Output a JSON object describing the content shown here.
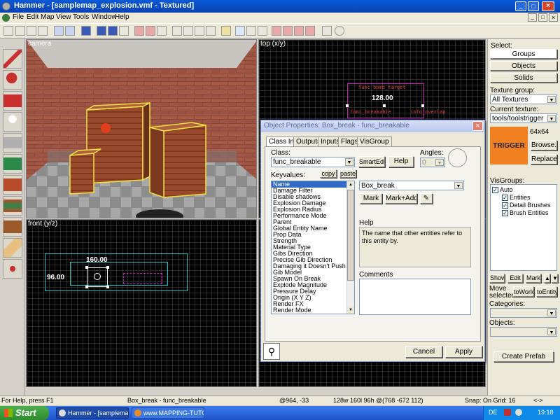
{
  "window": {
    "title": "Hammer - [samplemap_explosion.vmf - Textured]"
  },
  "menu": {
    "items": [
      "File",
      "Edit",
      "Map",
      "View",
      "Tools",
      "Window",
      "Help"
    ]
  },
  "viewports": {
    "camera": "camera",
    "top": "top (x/y)",
    "front": "front (y/z)",
    "top_entity_label_1": "func_bomb_target",
    "top_entity_label_2": "func_breakable",
    "top_entity_label_3": "info_overlap",
    "top_dimension": "128.00",
    "front_width": "160.00",
    "front_height": "96.00"
  },
  "dialog": {
    "title": "Object Properties: Box_break - func_breakable",
    "tabs": [
      "Class Info",
      "Outputs",
      "Inputs",
      "Flags",
      "VisGroup"
    ],
    "class_label": "Class:",
    "class_value": "func_breakable",
    "smartedit_label": "SmartEdit",
    "help_button": "Help",
    "angles_label": "Angles:",
    "angles_value": "0",
    "keyvalues_label": "Keyvalues:",
    "copy_label": "copy",
    "paste_label": "paste",
    "keyvalues": [
      "Name",
      "Damage Filter",
      "Disable shadows",
      "Explosion Damage",
      "Explosion Radius",
      "Performance Mode",
      "Parent",
      "Global Entity Name",
      "Prop Data",
      "Strength",
      "Material Type",
      "Gibs Direction",
      "Precise Gib Direction",
      "Damaging it Doesn't Push It",
      "Gib Model",
      "Spawn On Break",
      "Explode Magnitude",
      "Pressure Delay",
      "Origin (X Y Z)",
      "Render FX",
      "Render Mode"
    ],
    "value_field": "Box_break",
    "mark_label": "Mark",
    "markadd_label": "Mark+Add",
    "help_section_label": "Help",
    "help_text": "The name that other entities refer to this entity by.",
    "comments_label": "Comments",
    "cancel_label": "Cancel",
    "apply_label": "Apply"
  },
  "rightpanel": {
    "select_label": "Select:",
    "groups_label": "Groups",
    "objects_label": "Objects",
    "solids_label": "Solids",
    "texture_group_label": "Texture group:",
    "texture_group_value": "All Textures",
    "current_texture_label": "Current texture:",
    "current_texture_value": "tools/toolstrigger",
    "texture_preview_text": "TRIGGER",
    "texture_size": "64x64",
    "browse_label": "Browse...",
    "replace_label": "Replace...",
    "visgroups_label": "VisGroups:",
    "visgroup_root": "Auto",
    "visgroup_children": [
      "Entities",
      "Detail Brushes",
      "Brush Entities"
    ],
    "show_label": "Show",
    "edit_label": "Edit",
    "mark_label": "Mark",
    "move_selected_label": "Move selected:",
    "toworld_label": "toWorld",
    "toentity_label": "toEntity",
    "categories_label": "Categories:",
    "objects_list_label": "Objects:",
    "create_prefab_label": "Create Prefab"
  },
  "statusbar": {
    "help": "For Help, press F1",
    "selection": "Box_break - func_breakable",
    "coords": "@964, -33",
    "dimensions": "128w 160l 96h @(768 -672 112)",
    "snap": "Snap: On Grid: 16",
    "nav": "<->"
  },
  "taskbar": {
    "start_label": "Start",
    "task1": "Hammer - [samplema...",
    "task2": "www.MAPPING-TUTO...",
    "lang": "DE",
    "clock": "19:18"
  },
  "colors": {
    "accent": "#316ac5",
    "titlebar": "#0a246a",
    "taskbar": "#245edb",
    "start": "#3c8f3c",
    "wood": "#9a4a2a"
  }
}
